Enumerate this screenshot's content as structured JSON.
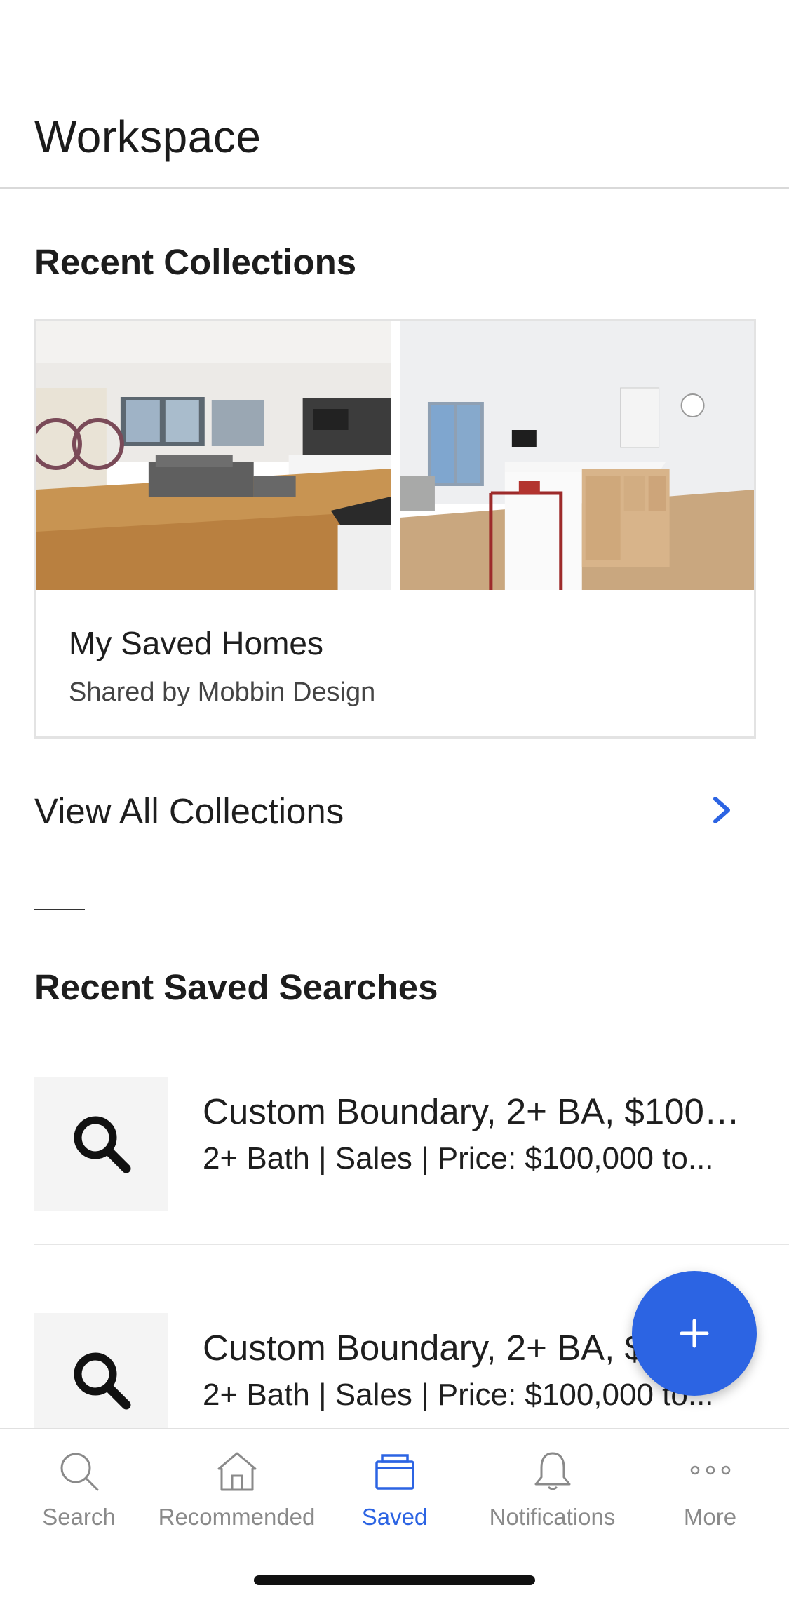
{
  "header": {
    "title": "Workspace"
  },
  "collections": {
    "heading": "Recent Collections",
    "cards": [
      {
        "name": "My Saved Homes",
        "subtitle": "Shared by Mobbin  Design"
      }
    ],
    "view_all_label": "View All Collections"
  },
  "saved_searches": {
    "heading": "Recent Saved Searches",
    "items": [
      {
        "title": "Custom Boundary, 2+ BA, $100K...",
        "subtitle": "2+ Bath | Sales | Price: $100,000 to..."
      },
      {
        "title": "Custom Boundary, 2+ BA, $100K...",
        "subtitle": "2+ Bath | Sales | Price: $100,000 to..."
      }
    ]
  },
  "fab": {
    "icon": "plus-icon"
  },
  "tabbar": {
    "tabs": [
      {
        "label": "Search",
        "icon": "search-icon",
        "active": false
      },
      {
        "label": "Recommended",
        "icon": "home-icon",
        "active": false
      },
      {
        "label": "Saved",
        "icon": "saved-folder-icon",
        "active": true
      },
      {
        "label": "Notifications",
        "icon": "bell-icon",
        "active": false
      },
      {
        "label": "More",
        "icon": "more-dots-icon",
        "active": false
      }
    ]
  },
  "colors": {
    "accent": "#2c64e3",
    "inactive": "#8a8a8a",
    "thumb_bg": "#f4f4f4"
  }
}
